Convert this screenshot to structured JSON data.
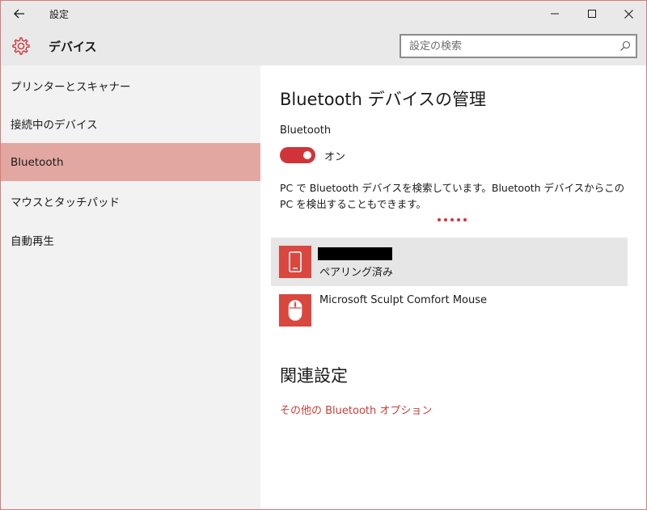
{
  "window": {
    "title": "設定"
  },
  "header": {
    "title": "デバイス",
    "search_placeholder": "設定の検索"
  },
  "sidebar": {
    "items": [
      {
        "label": "プリンターとスキャナー"
      },
      {
        "label": "接続中のデバイス"
      },
      {
        "label": "Bluetooth",
        "selected": true
      },
      {
        "label": "マウスとタッチパッド"
      },
      {
        "label": "自動再生"
      }
    ]
  },
  "main": {
    "title": "Bluetooth デバイスの管理",
    "bluetooth_label": "Bluetooth",
    "toggle_state": "オン",
    "description": "PC で Bluetooth デバイスを検索しています。Bluetooth デバイスからこの PC を検出することもできます。",
    "devices": [
      {
        "name": "",
        "status": "ペアリング済み",
        "icon": "phone-icon",
        "redacted": true
      },
      {
        "name": "Microsoft Sculpt Comfort Mouse",
        "status": "",
        "icon": "mouse-icon"
      }
    ],
    "related_title": "関連設定",
    "related_link": "その他の Bluetooth オプション"
  },
  "colors": {
    "accent": "#d13438",
    "selected_nav": "#e3a7a1",
    "device_icon_bg": "#d9473f",
    "link": "#c9403a"
  }
}
